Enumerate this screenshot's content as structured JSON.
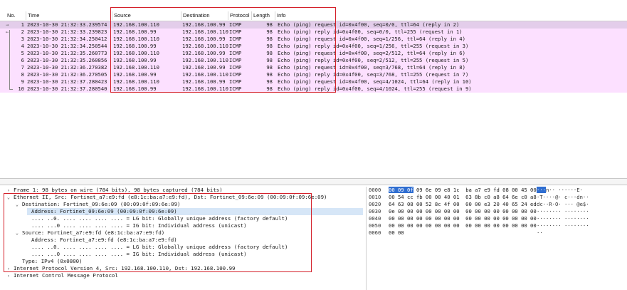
{
  "packet_list": {
    "columns": [
      "No.",
      "Time",
      "Source",
      "Destination",
      "Protocol",
      "Length",
      "Info"
    ],
    "rows": [
      {
        "gutter": "→",
        "no": "1",
        "time": "2023-10-30 21:32:33.239574",
        "src": "192.168.100.110",
        "dst": "192.168.100.99",
        "proto": "ICMP",
        "len": "98",
        "info": "Echo (ping) request  id=0x4f00, seq=0/0, ttl=64 (reply in 2)"
      },
      {
        "gutter": "←",
        "no": "2",
        "time": "2023-10-30 21:32:33.239823",
        "src": "192.168.100.99",
        "dst": "192.168.100.110",
        "proto": "ICMP",
        "len": "98",
        "info": "Echo (ping) reply    id=0x4f00, seq=0/0, ttl=255 (request in 1)"
      },
      {
        "gutter": "",
        "no": "3",
        "time": "2023-10-30 21:32:34.250412",
        "src": "192.168.100.110",
        "dst": "192.168.100.99",
        "proto": "ICMP",
        "len": "98",
        "info": "Echo (ping) request  id=0x4f00, seq=1/256, ttl=64 (reply in 4)"
      },
      {
        "gutter": "",
        "no": "4",
        "time": "2023-10-30 21:32:34.250544",
        "src": "192.168.100.99",
        "dst": "192.168.100.110",
        "proto": "ICMP",
        "len": "98",
        "info": "Echo (ping) reply    id=0x4f00, seq=1/256, ttl=255 (request in 3)"
      },
      {
        "gutter": "",
        "no": "5",
        "time": "2023-10-30 21:32:35.260773",
        "src": "192.168.100.110",
        "dst": "192.168.100.99",
        "proto": "ICMP",
        "len": "98",
        "info": "Echo (ping) request  id=0x4f00, seq=2/512, ttl=64 (reply in 6)"
      },
      {
        "gutter": "",
        "no": "6",
        "time": "2023-10-30 21:32:35.260856",
        "src": "192.168.100.99",
        "dst": "192.168.100.110",
        "proto": "ICMP",
        "len": "98",
        "info": "Echo (ping) reply    id=0x4f00, seq=2/512, ttl=255 (request in 5)"
      },
      {
        "gutter": "",
        "no": "7",
        "time": "2023-10-30 21:32:36.270382",
        "src": "192.168.100.110",
        "dst": "192.168.100.99",
        "proto": "ICMP",
        "len": "98",
        "info": "Echo (ping) request  id=0x4f00, seq=3/768, ttl=64 (reply in 8)"
      },
      {
        "gutter": "",
        "no": "8",
        "time": "2023-10-30 21:32:36.270505",
        "src": "192.168.100.99",
        "dst": "192.168.100.110",
        "proto": "ICMP",
        "len": "98",
        "info": "Echo (ping) reply    id=0x4f00, seq=3/768, ttl=255 (request in 7)"
      },
      {
        "gutter": "",
        "no": "9",
        "time": "2023-10-30 21:32:37.280423",
        "src": "192.168.100.110",
        "dst": "192.168.100.99",
        "proto": "ICMP",
        "len": "98",
        "info": "Echo (ping) request  id=0x4f00, seq=4/1024, ttl=64 (reply in 10)"
      },
      {
        "gutter": "",
        "no": "10",
        "time": "2023-10-30 21:32:37.280540",
        "src": "192.168.100.99",
        "dst": "192.168.100.110",
        "proto": "ICMP",
        "len": "98",
        "info": "Echo (ping) reply    id=0x4f00, seq=4/1024, ttl=255 (request in 9)"
      }
    ]
  },
  "details": {
    "lines": [
      {
        "toggle": "›",
        "indent": 0,
        "text": "Frame 1: 98 bytes on wire (784 bits), 98 bytes captured (784 bits)"
      },
      {
        "toggle": "⌄",
        "indent": 0,
        "text": "Ethernet II, Src: Fortinet_a7:e9:fd (e8:1c:ba:a7:e9:fd), Dst: Fortinet_09:6e:09 (00:09:0f:09:6e:09)"
      },
      {
        "toggle": "⌄",
        "indent": 1,
        "text": "Destination: Fortinet_09:6e:09 (00:09:0f:09:6e:09)"
      },
      {
        "toggle": "",
        "indent": 2,
        "text": "Address: Fortinet_09:6e:09 (00:09:0f:09:6e:09)",
        "highlight": true
      },
      {
        "toggle": "",
        "indent": 2,
        "text": ".... ..0. .... .... .... .... = LG bit: Globally unique address (factory default)"
      },
      {
        "toggle": "",
        "indent": 2,
        "text": ".... ...0 .... .... .... .... = IG bit: Individual address (unicast)"
      },
      {
        "toggle": "⌄",
        "indent": 1,
        "text": "Source: Fortinet_a7:e9:fd (e8:1c:ba:a7:e9:fd)"
      },
      {
        "toggle": "",
        "indent": 2,
        "text": "Address: Fortinet_a7:e9:fd (e8:1c:ba:a7:e9:fd)"
      },
      {
        "toggle": "",
        "indent": 2,
        "text": ".... ..0. .... .... .... .... = LG bit: Globally unique address (factory default)"
      },
      {
        "toggle": "",
        "indent": 2,
        "text": ".... ...0 .... .... .... .... = IG bit: Individual address (unicast)"
      },
      {
        "toggle": "",
        "indent": 1,
        "text": "Type: IPv4 (0x0800)"
      },
      {
        "toggle": "›",
        "indent": 0,
        "text": "Internet Protocol Version 4, Src: 192.168.100.110, Dst: 192.168.100.99"
      },
      {
        "toggle": "›",
        "indent": 0,
        "text": "Internet Control Message Protocol"
      }
    ]
  },
  "bytes": {
    "rows": [
      {
        "off": "0000",
        "sel": "00 09 0f",
        "hex": " 09 6e 09 e8 1c  ba a7 e9 fd 08 00 45 00",
        "asel": "···",
        "ascii": "n·· ······E·"
      },
      {
        "off": "0010",
        "sel": "",
        "hex": "00 54 cc fb 00 00 40 01  63 8b c0 a8 64 6e c0 a8",
        "asel": "",
        "ascii": "·T····@· c···dn··"
      },
      {
        "off": "0020",
        "sel": "",
        "hex": "64 63 08 00 52 8c 4f 00  00 00 e3 20 40 65 24 ed",
        "asel": "",
        "ascii": "dc··R·O· ··· @e$·"
      },
      {
        "off": "0030",
        "sel": "",
        "hex": "0e 00 00 00 00 00 00 00  00 00 00 00 00 00 00 00",
        "asel": "",
        "ascii": "········ ········"
      },
      {
        "off": "0040",
        "sel": "",
        "hex": "00 00 00 00 00 00 00 00  00 00 00 00 00 00 00 00",
        "asel": "",
        "ascii": "········ ········"
      },
      {
        "off": "0050",
        "sel": "",
        "hex": "00 00 00 00 00 00 00 00  00 00 00 00 00 00 00 00",
        "asel": "",
        "ascii": "········ ········"
      },
      {
        "off": "0060",
        "sel": "",
        "hex": "00 00",
        "asel": "",
        "ascii": "··"
      }
    ]
  }
}
